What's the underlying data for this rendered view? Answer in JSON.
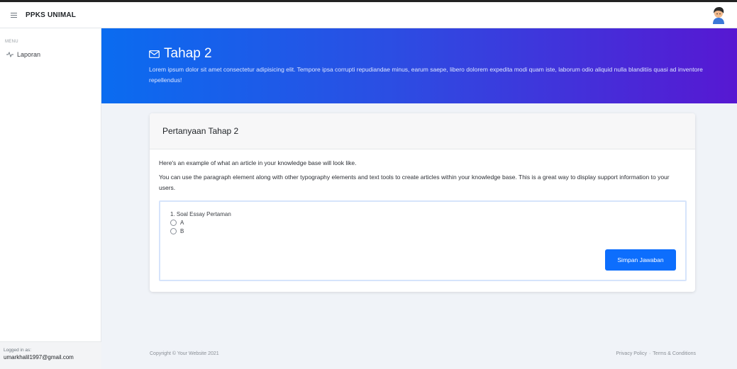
{
  "app": {
    "brand": "PPKS UNIMAL",
    "menu_icon": "hamburger-icon",
    "avatar_icon": "user-avatar"
  },
  "sidebar": {
    "heading": "MENU",
    "items": [
      {
        "label": "Laporan",
        "icon": "activity-icon"
      }
    ],
    "footer": {
      "logged_label": "Logged in as:",
      "user_email": "umarkhalil1997@gmail.com"
    }
  },
  "header": {
    "icon": "envelope-icon",
    "title": "Tahap 2",
    "description": "Lorem ipsum dolor sit amet consectetur adipisicing elit. Tempore ipsa corrupti repudiandae minus, earum saepe, libero dolorem expedita modi quam iste, laborum odio aliquid nulla blanditiis quasi ad inventore repellendus!"
  },
  "card": {
    "title": "Pertanyaan Tahap 2",
    "paragraphs": [
      "Here's an example of what an article in your knowledge base will look like.",
      "You can use the paragraph element along with other typography elements and text tools to create articles within your knowledge base. This is a great way to display support information to your users."
    ],
    "question": {
      "text": "1. Soal Essay Pertaman",
      "options": [
        "A",
        "B"
      ]
    },
    "submit_label": "Simpan Jawaban"
  },
  "footer": {
    "copyright": "Copyright © Your Website 2021",
    "privacy": "Privacy Policy",
    "separator": "·",
    "terms": "Terms & Conditions"
  },
  "colors": {
    "primary": "#0d6efd",
    "gradient_start": "#0a6cf0",
    "gradient_end": "#5718d2"
  }
}
